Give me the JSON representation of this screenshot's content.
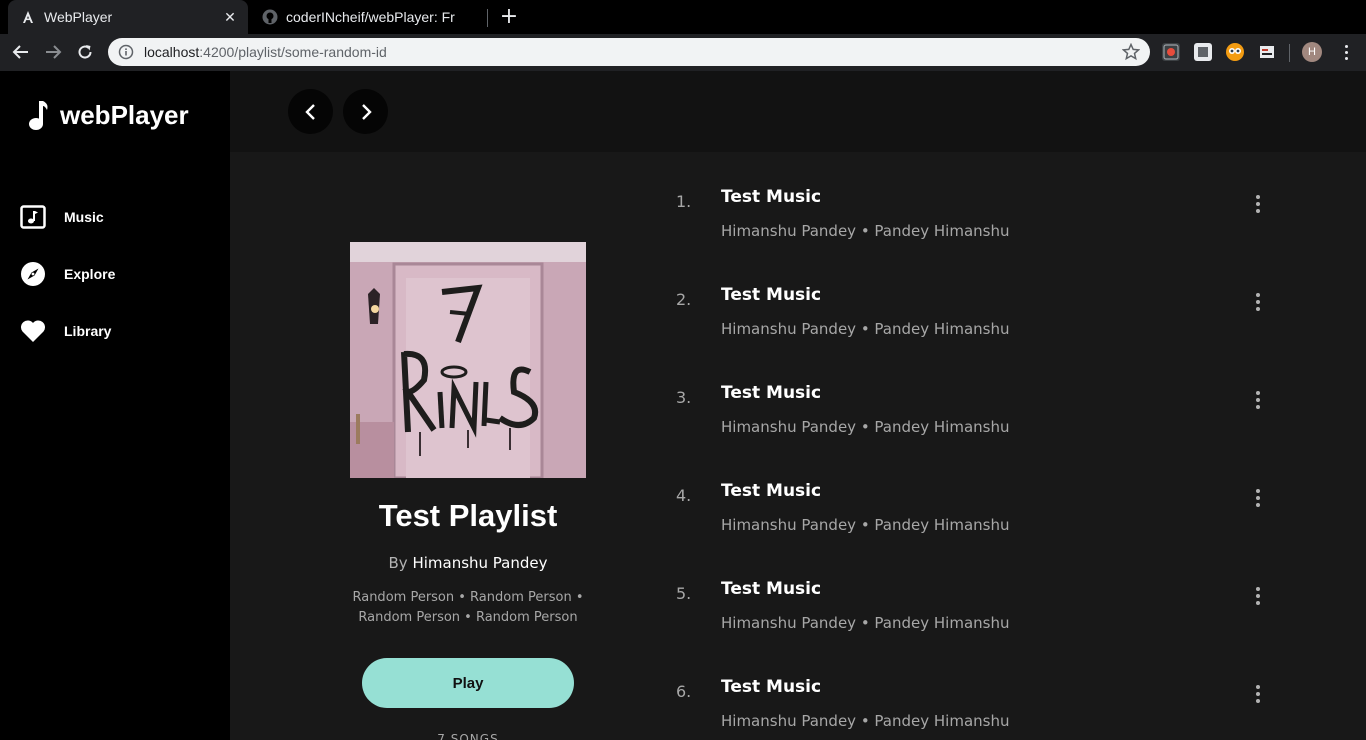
{
  "browser": {
    "tabs": [
      {
        "title": "WebPlayer",
        "active": true,
        "favicon": "angular-icon"
      },
      {
        "title": "coderINcheif/webPlayer: Fr",
        "active": false,
        "favicon": "github-icon"
      }
    ],
    "url_host": "localhost",
    "url_path": ":4200/playlist/some-random-id",
    "profile_initial": "H"
  },
  "app": {
    "brand": "webPlayer",
    "nav": [
      {
        "label": "Music",
        "icon": "music-note-square-icon"
      },
      {
        "label": "Explore",
        "icon": "compass-icon"
      },
      {
        "label": "Library",
        "icon": "heart-icon"
      }
    ]
  },
  "playlist": {
    "title": "Test Playlist",
    "by_prefix": "By",
    "owner": "Himanshu Pandey",
    "artists_line1": "Random Person • Random Person •",
    "artists_line2": "Random Person • Random Person",
    "play_label": "Play",
    "song_count": "7 SONGS"
  },
  "tracks": [
    {
      "num": "1.",
      "name": "Test Music",
      "artists": "Himanshu Pandey • Pandey Himanshu"
    },
    {
      "num": "2.",
      "name": "Test Music",
      "artists": "Himanshu Pandey • Pandey Himanshu"
    },
    {
      "num": "3.",
      "name": "Test Music",
      "artists": "Himanshu Pandey • Pandey Himanshu"
    },
    {
      "num": "4.",
      "name": "Test Music",
      "artists": "Himanshu Pandey • Pandey Himanshu"
    },
    {
      "num": "5.",
      "name": "Test Music",
      "artists": "Himanshu Pandey • Pandey Himanshu"
    },
    {
      "num": "6.",
      "name": "Test Music",
      "artists": "Himanshu Pandey • Pandey Himanshu"
    }
  ],
  "colors": {
    "accent": "#96e0d4",
    "sidebar_bg": "#000000",
    "content_bg": "#181818",
    "topbar_bg": "#121212"
  }
}
